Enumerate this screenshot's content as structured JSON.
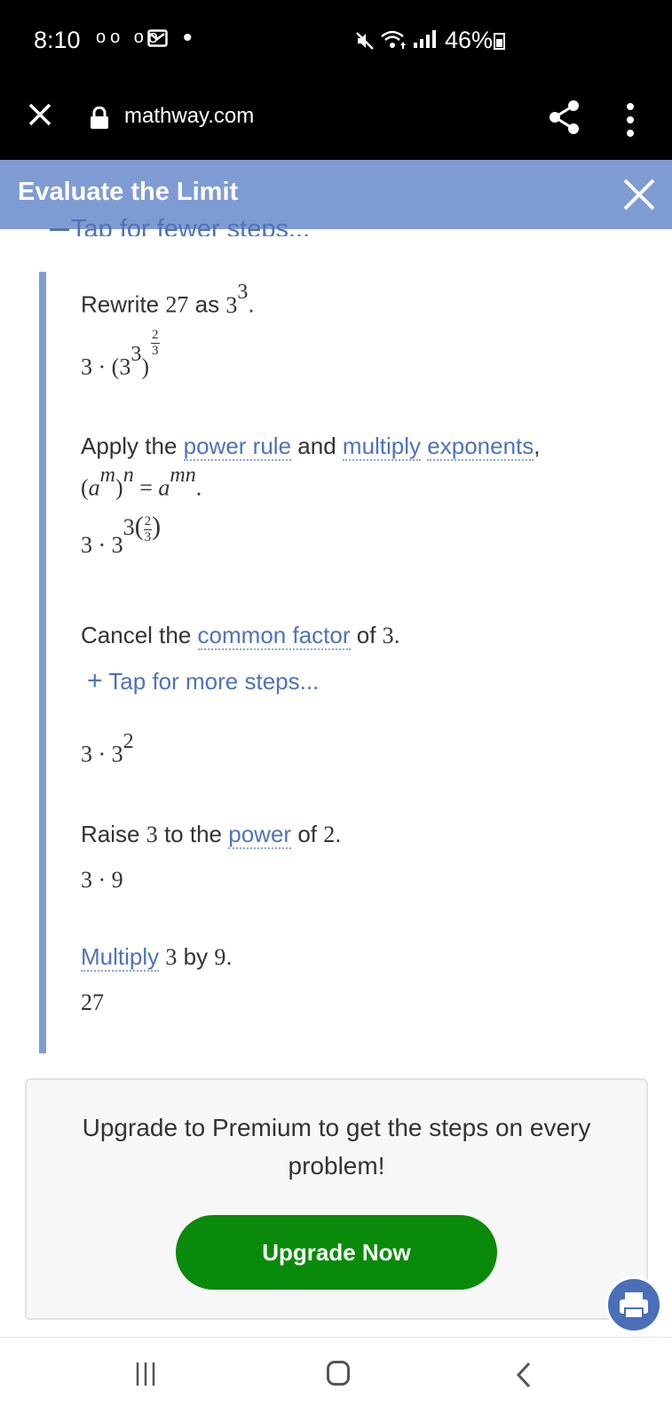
{
  "status_bar": {
    "time": "8:10",
    "notification_icons": "oo oo",
    "battery": "46%"
  },
  "browser": {
    "url": "mathway.com"
  },
  "panel": {
    "title": "Evaluate the Limit",
    "cutoff_link": "Tap for fewer steps..."
  },
  "steps": {
    "step1": {
      "text_a": "Rewrite",
      "n27": "27",
      "text_as": "as",
      "base": "3",
      "exp": "3",
      "period": ".",
      "expr_coef": "3",
      "expr_dot": "·",
      "expr_base": "3",
      "expr_inner_exp": "3",
      "expr_frac_num": "2",
      "expr_frac_den": "3"
    },
    "step2": {
      "text_a": "Apply the",
      "link1": "power rule",
      "text_and": "and",
      "link2": "multiply",
      "link3": "exponents",
      "comma": ",",
      "rule_a": "a",
      "rule_m": "m",
      "rule_n": "n",
      "rule_eq": "=",
      "rule_mn": "mn",
      "expr_coef": "3",
      "expr_dot": "·",
      "expr_base": "3",
      "expr_exp_coef": "3",
      "expr_frac_num": "2",
      "expr_frac_den": "3"
    },
    "step3": {
      "text_a": "Cancel the",
      "link1": "common factor",
      "text_of": "of",
      "n3": "3",
      "period": ".",
      "more_steps": "Tap for more steps...",
      "expr_coef": "3",
      "expr_dot": "·",
      "expr_base": "3",
      "expr_exp": "2"
    },
    "step4": {
      "text_a": "Raise",
      "n3": "3",
      "text_to": "to the",
      "link1": "power",
      "text_of": "of",
      "n2": "2",
      "period": ".",
      "expr": "3 · 9"
    },
    "step5": {
      "link1": "Multiply",
      "n3": "3",
      "text_by": "by",
      "n9": "9",
      "period": ".",
      "result": "27"
    }
  },
  "upgrade": {
    "message": "Upgrade to Premium to get the steps on every problem!",
    "button_label": "Upgrade Now"
  },
  "colors": {
    "accent": "#7f9bd3",
    "link": "#4f73b8",
    "upgrade_button": "#0a8a0a",
    "print_button": "#4a6fb8"
  }
}
